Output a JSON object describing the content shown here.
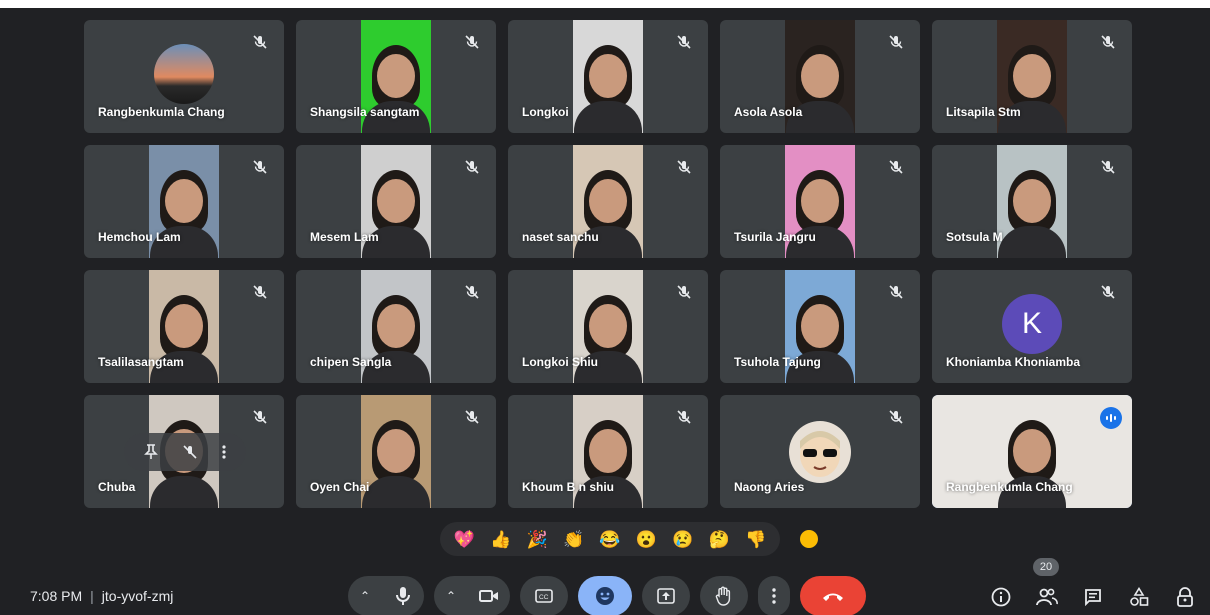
{
  "meeting": {
    "time": "7:08 PM",
    "code": "jto-yvof-zmj",
    "participant_count": "20"
  },
  "tiles": [
    {
      "name": "Rangbenkumla Chang",
      "kind": "avatar-photo",
      "video_bg": "#3c4043",
      "muted": true
    },
    {
      "name": "Shangsila sangtam",
      "kind": "video",
      "video_bg": "#2ecc2e",
      "muted": true
    },
    {
      "name": "Longkoi",
      "kind": "video",
      "video_bg": "#d8d8d8",
      "muted": true
    },
    {
      "name": "Asola Asola",
      "kind": "video",
      "video_bg": "#2a2320",
      "muted": true
    },
    {
      "name": "Litsapila Stm",
      "kind": "video",
      "video_bg": "#3a2a24",
      "muted": true
    },
    {
      "name": "Hemchou Lam",
      "kind": "video",
      "video_bg": "#7a8fa8",
      "muted": true
    },
    {
      "name": "Mesem Lam",
      "kind": "video",
      "video_bg": "#cfcfcf",
      "muted": true
    },
    {
      "name": "naset sanchu",
      "kind": "video",
      "video_bg": "#d6c7b5",
      "muted": true
    },
    {
      "name": "Tsurila Jangru",
      "kind": "video",
      "video_bg": "#e38fc4",
      "muted": true
    },
    {
      "name": "Sotsula M",
      "kind": "video",
      "video_bg": "#b8c2c4",
      "muted": true
    },
    {
      "name": "Tsalilasangtam",
      "kind": "video",
      "video_bg": "#c9b9a6",
      "muted": true
    },
    {
      "name": "chipen Sangla",
      "kind": "video",
      "video_bg": "#c2c5c8",
      "muted": true
    },
    {
      "name": "Longkoi Shiu",
      "kind": "video",
      "video_bg": "#d9d4cc",
      "muted": true
    },
    {
      "name": "Tsuhola Tajung",
      "kind": "video",
      "video_bg": "#7da9d6",
      "muted": true
    },
    {
      "name": "Khoniamba Khoniamba",
      "kind": "avatar-letter",
      "letter": "K",
      "muted": true
    },
    {
      "name": "Chuba",
      "kind": "video",
      "video_bg": "#cfc8c0",
      "muted": true,
      "hover": true
    },
    {
      "name": "Oyen Chai",
      "kind": "video",
      "video_bg": "#b89a74",
      "muted": true
    },
    {
      "name": "Khoum B n shiu",
      "kind": "video",
      "video_bg": "#d7cfc6",
      "muted": true
    },
    {
      "name": "Naong Aries",
      "kind": "avatar-sticker",
      "muted": true
    },
    {
      "name": "Rangbenkumla Chang",
      "kind": "video-wide",
      "video_bg": "#e9e6e2",
      "speaking": true,
      "active": true
    }
  ],
  "reactions": [
    "💖",
    "👍",
    "🎉",
    "👏",
    "😂",
    "😮",
    "😢",
    "🤔",
    "👎"
  ],
  "icons": {
    "mic": "microphone-icon",
    "camera": "camera-icon",
    "captions": "captions-icon",
    "emoji": "emoji-icon",
    "present": "present-icon",
    "hand": "raise-hand-icon",
    "more": "more-options-icon",
    "end": "end-call-icon",
    "info": "info-icon",
    "people": "people-icon",
    "chat": "chat-icon",
    "activities": "activities-icon",
    "host": "host-controls-icon"
  },
  "colors": {
    "background": "#202124",
    "tile": "#3c4043",
    "accent": "#8ab4f8",
    "end_call": "#ea4335",
    "speaking": "#1a73e8"
  }
}
